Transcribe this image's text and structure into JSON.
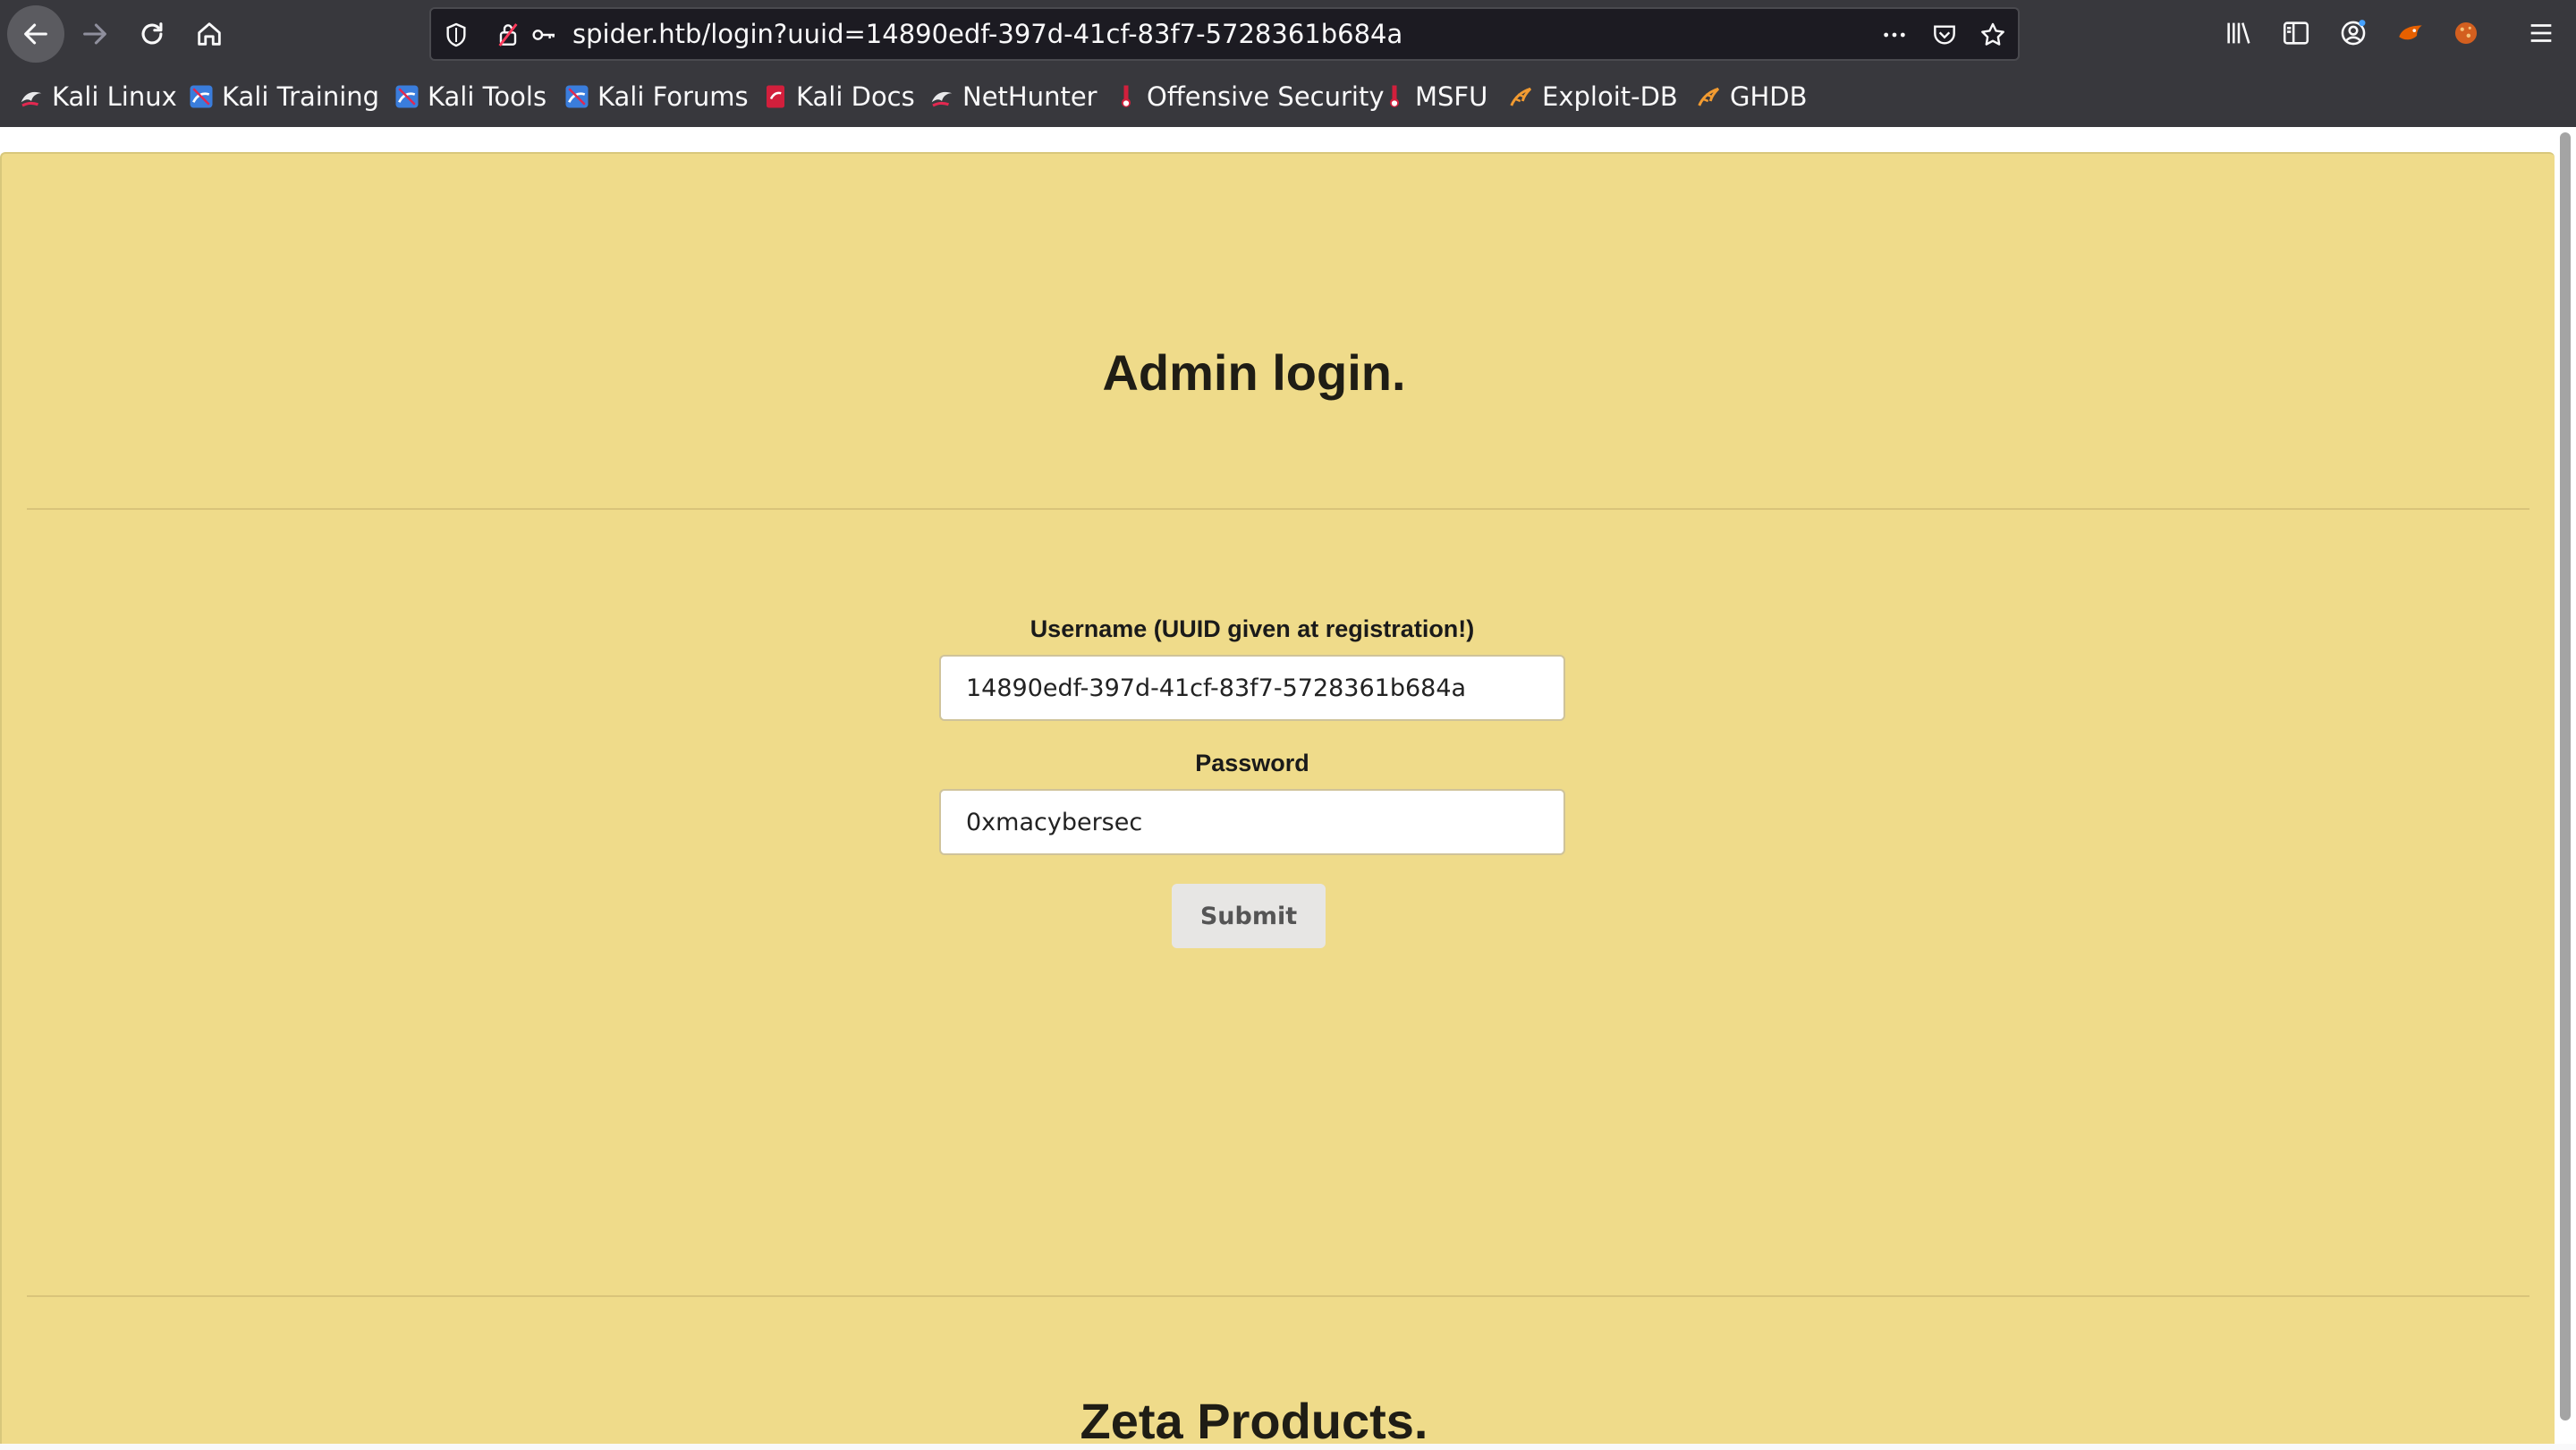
{
  "browser": {
    "url": "spider.htb/login?uuid=14890edf-397d-41cf-83f7-5728361b684a",
    "bookmarks": [
      {
        "label": "Kali Linux",
        "icon": "kali-dragon-icon"
      },
      {
        "label": "Kali Training",
        "icon": "kali-training-icon"
      },
      {
        "label": "Kali Tools",
        "icon": "kali-tools-icon"
      },
      {
        "label": "Kali Forums",
        "icon": "kali-forums-icon"
      },
      {
        "label": "Kali Docs",
        "icon": "kali-docs-icon"
      },
      {
        "label": "NetHunter",
        "icon": "nethunter-icon"
      },
      {
        "label": "Offensive Security",
        "icon": "offsec-icon"
      },
      {
        "label": "MSFU",
        "icon": "msfu-icon"
      },
      {
        "label": "Exploit-DB",
        "icon": "exploit-db-icon"
      },
      {
        "label": "GHDB",
        "icon": "ghdb-icon"
      }
    ]
  },
  "page": {
    "title": "Admin login.",
    "form": {
      "username_label": "Username (UUID given at registration!)",
      "username_value": "14890edf-397d-41cf-83f7-5728361b684a",
      "password_label": "Password",
      "password_value": "0xmacybersec",
      "submit_label": "Submit"
    },
    "products_title": "Zeta Products."
  },
  "colors": {
    "page_background": "#efdb8a",
    "chrome_background": "#38383d"
  }
}
